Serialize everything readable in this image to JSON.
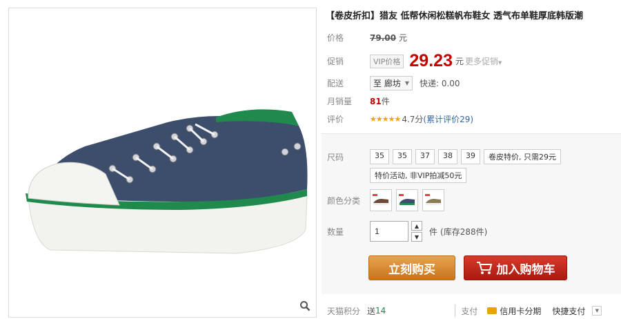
{
  "product": {
    "title": "【卷皮折扣】猎友 低帮休闲松糕帆布鞋女 透气布单鞋厚底韩版潮"
  },
  "price": {
    "label": "价格",
    "original": "79.00",
    "unit": "元"
  },
  "promo": {
    "label": "促销",
    "vip_tag": "VIP价格",
    "price": "29.23",
    "unit": "元",
    "more": "更多促销"
  },
  "delivery": {
    "label": "配送",
    "destination": "至 廊坊",
    "express": "快递: 0.00"
  },
  "sales": {
    "label": "月销量",
    "count": "81",
    "unit": "件"
  },
  "rating": {
    "label": "评价",
    "stars": "★★★★★",
    "score": "4.7分",
    "reviews": "(累计评价29)"
  },
  "size": {
    "label": "尺码",
    "options": [
      "35",
      "35",
      "37",
      "38",
      "39",
      "卷皮特价, 只需29元",
      "特价活动, 非VIP拍减50元"
    ]
  },
  "color": {
    "label": "颜色分类"
  },
  "quantity": {
    "label": "数量",
    "value": "1",
    "unit": "件",
    "stock": "(库存288件)"
  },
  "actions": {
    "buy_now": "立刻购买",
    "add_to_cart": "加入购物车"
  },
  "bottom": {
    "points_label": "天猫积分",
    "points_prefix": "送",
    "points_value": "14",
    "pay_label": "支付",
    "installment": "信用卡分期",
    "quick_pay": "快捷支付"
  },
  "colors": {
    "accent_red": "#c40000",
    "buy_orange": "#d8893a",
    "cart_red": "#c0281c",
    "link_blue": "#3366aa",
    "shoe_denim": "#3d4d6c",
    "shoe_green": "#1f8a4c"
  }
}
